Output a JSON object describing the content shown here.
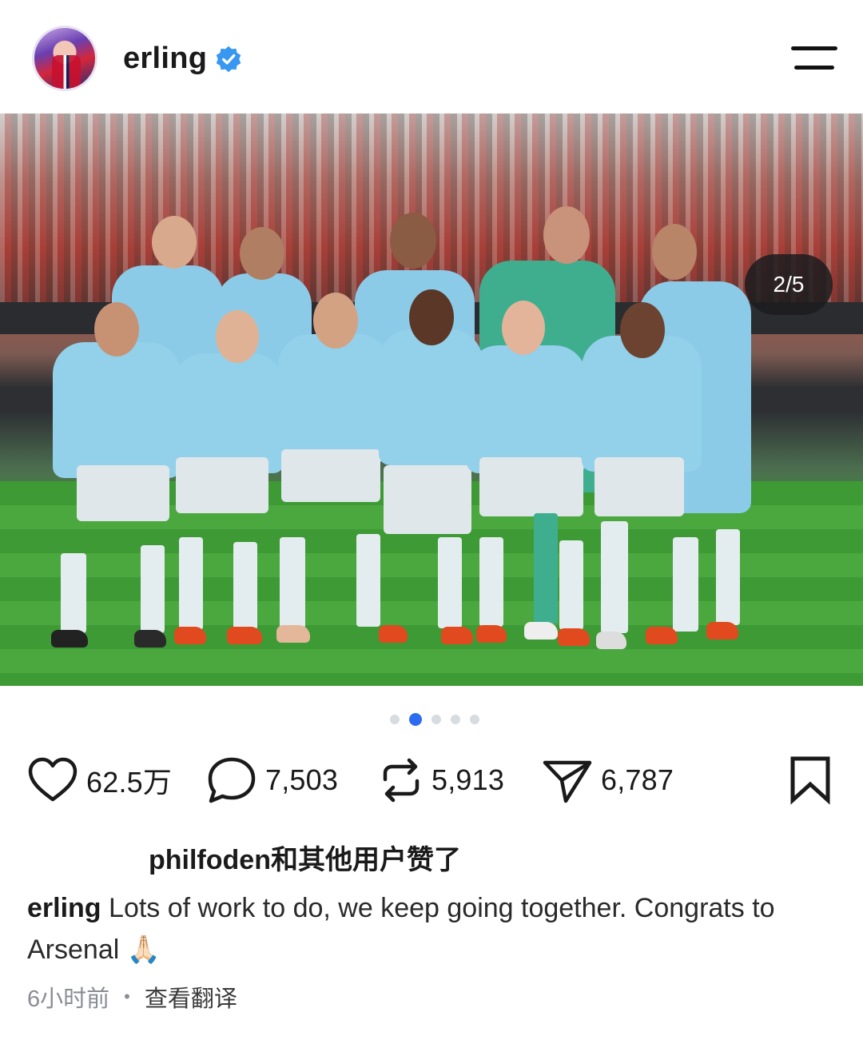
{
  "header": {
    "username": "erling",
    "verified": true
  },
  "post": {
    "image_counter": "2/5",
    "carousel": {
      "total": 5,
      "active_index": 1
    }
  },
  "actions": {
    "likes": "62.5万",
    "comments": "7,503",
    "reposts": "5,913",
    "shares": "6,787"
  },
  "liked_by_text": "philfoden和其他用户赞了",
  "caption": {
    "username": "erling",
    "text": "Lots of work to do, we keep going together. Congrats to Arsenal 🙏🏻"
  },
  "meta": {
    "time_ago": "6小时前",
    "separator": "•",
    "translate_label": "查看翻译"
  },
  "colors": {
    "accent": "#2d6cf0",
    "verified": "#3897f0",
    "text": "#1a1a1a",
    "muted": "#8a8d93"
  },
  "icons": [
    "verified-badge-icon",
    "menu-icon",
    "heart-icon",
    "comment-icon",
    "repost-icon",
    "share-icon",
    "bookmark-icon"
  ]
}
